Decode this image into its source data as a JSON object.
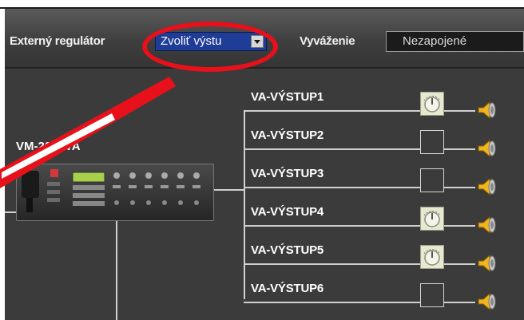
{
  "toolbar": {
    "external_regulator_label": "Externý regulátor",
    "output_select_value": "Zvoliť výstu",
    "balance_label": "Vyváženie",
    "balance_value": "Nezapojené"
  },
  "device": {
    "name": "VM-2000VA"
  },
  "outputs": [
    {
      "label": "VA-VÝSTUP1",
      "control": "knob"
    },
    {
      "label": "VA-VÝSTUP2",
      "control": "empty"
    },
    {
      "label": "VA-VÝSTUP3",
      "control": "empty"
    },
    {
      "label": "VA-VÝSTUP4",
      "control": "knob"
    },
    {
      "label": "VA-VÝSTUP5",
      "control": "knob"
    },
    {
      "label": "VA-VÝSTUP6",
      "control": "empty"
    }
  ],
  "icons": {
    "speaker": "speaker-icon",
    "knob": "volume-knob-icon",
    "dropdown": "chevron-down-icon"
  },
  "colors": {
    "callout": "#e8101a",
    "select_bg": "#1f3c96",
    "panel_bg": "#3b3b3b"
  }
}
